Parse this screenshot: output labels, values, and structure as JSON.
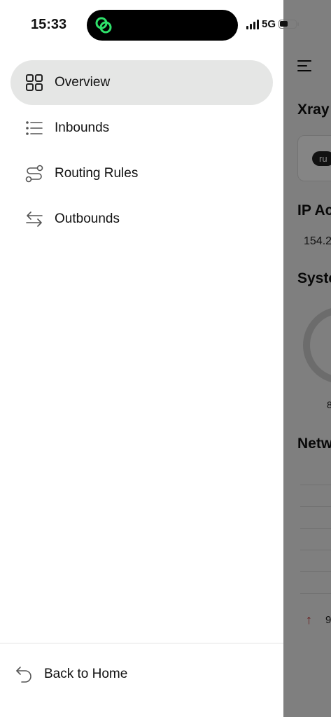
{
  "status_bar": {
    "time": "15:33",
    "network": "5G",
    "battery_level": 0.55
  },
  "drawer": {
    "nav_items": [
      {
        "label": "Overview",
        "icon": "grid-icon",
        "active": true
      },
      {
        "label": "Inbounds",
        "icon": "list-icon",
        "active": false
      },
      {
        "label": "Routing Rules",
        "icon": "route-icon",
        "active": false
      },
      {
        "label": "Outbounds",
        "icon": "swap-arrows-icon",
        "active": false
      }
    ],
    "footer": {
      "label": "Back to Home",
      "icon": "back-arrow-icon"
    }
  },
  "background": {
    "title_1": "Xray",
    "pill": "ru",
    "section_ip": "IP Ac",
    "ip_value": "154.2",
    "section_system": "Syste",
    "gauge_value": "8",
    "section_network": "Netw",
    "upload_value": "9"
  },
  "colors": {
    "active_bg": "#e5e6e5",
    "overlay": "#7a7a7a",
    "island_icon": "#2ee06a",
    "upload_arrow": "#c62828"
  }
}
